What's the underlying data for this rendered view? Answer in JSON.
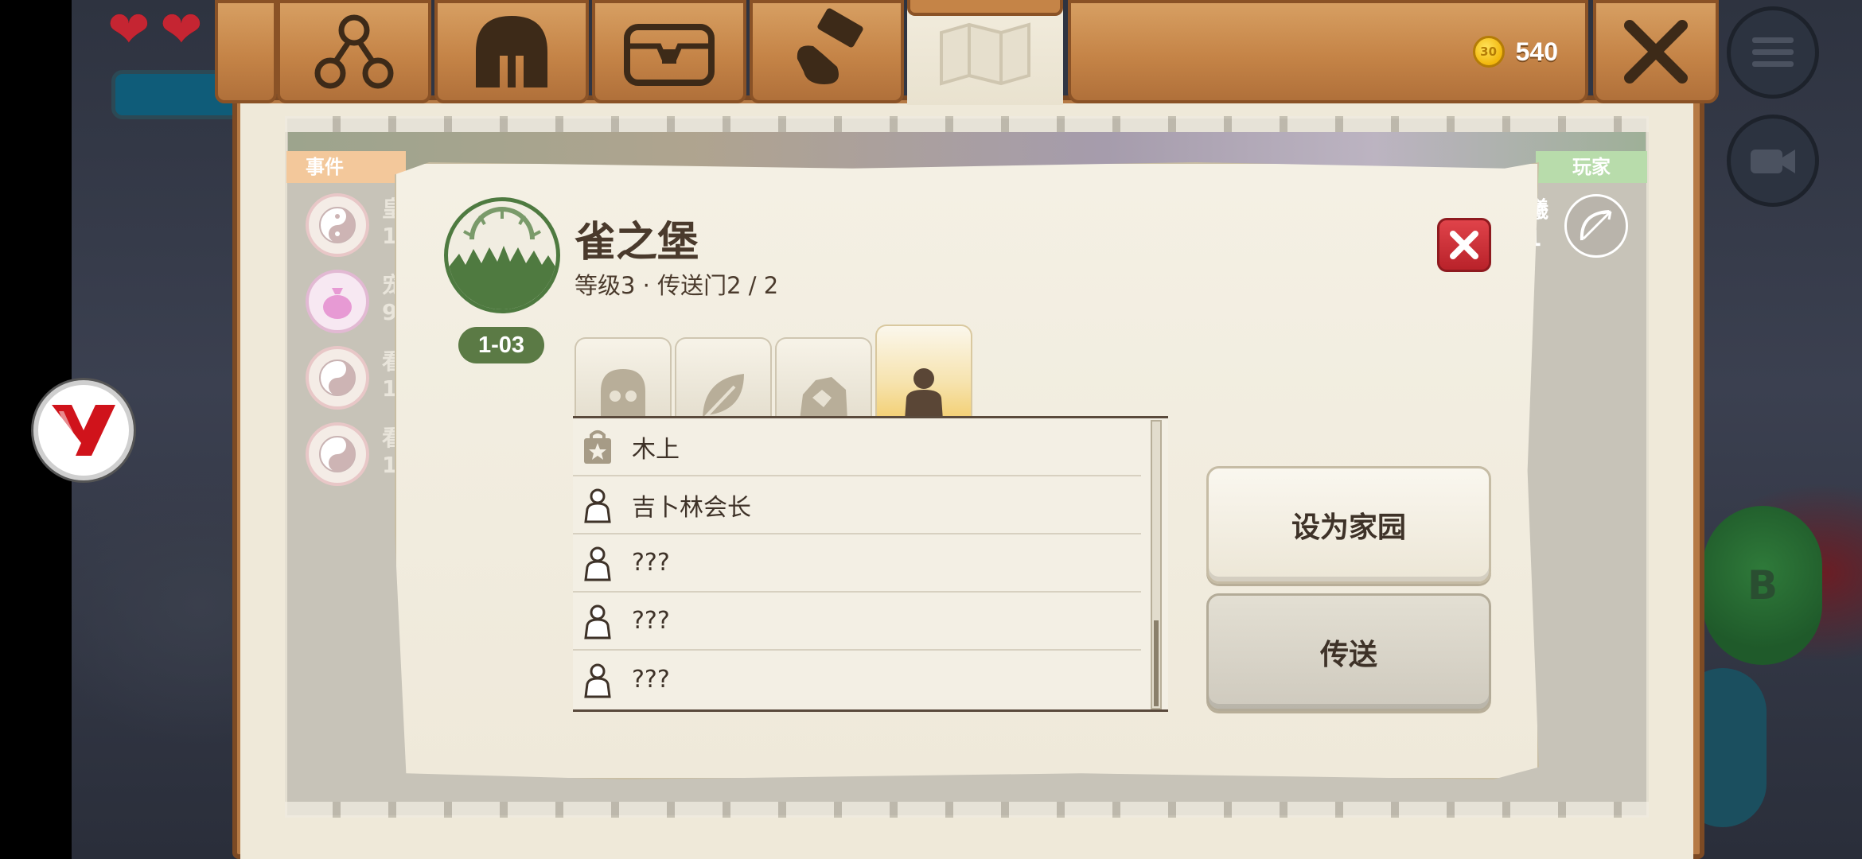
{
  "hud": {
    "hearts": [
      "heart-full",
      "heart-full"
    ],
    "yy_logo_text": "Y",
    "b_button_label": "B"
  },
  "tabbar": {
    "tabs": [
      {
        "name": "network-icon"
      },
      {
        "name": "helmet-icon"
      },
      {
        "name": "chest-icon"
      },
      {
        "name": "hammer-icon"
      },
      {
        "name": "map-icon",
        "active": true
      }
    ],
    "coins": "540",
    "coin_symbol": "30"
  },
  "journal": {
    "events_header": "事件",
    "players_header": "玩家",
    "event_peek": [
      {
        "t": "皇",
        "n": "1"
      },
      {
        "t": "宠",
        "n": "9"
      },
      {
        "t": "看",
        "n": "1"
      },
      {
        "t": "看",
        "n": "1"
      }
    ],
    "player_peek": {
      "t": "曦",
      "n": "1"
    }
  },
  "location": {
    "title": "雀之堡",
    "subtitle": "等级3 · 传送门2 / 2",
    "badge": "1-03",
    "tabs": [
      "skull-icon",
      "leaf-icon",
      "ore-icon",
      "person-icon"
    ],
    "active_tab": 3,
    "npcs": [
      {
        "icon": "shop-bag-icon",
        "label": "木上"
      },
      {
        "icon": "person-outline-icon",
        "label": "吉卜林会长"
      },
      {
        "icon": "person-outline-icon",
        "label": "???"
      },
      {
        "icon": "person-outline-icon",
        "label": "???"
      },
      {
        "icon": "person-outline-icon",
        "label": "???"
      }
    ],
    "btn_set_home": "设为家园",
    "btn_teleport": "传送"
  },
  "colors": {
    "wood": "#c58447",
    "paper": "#efe9da",
    "accent_green": "#5b7a45",
    "close_red": "#c82c33"
  }
}
